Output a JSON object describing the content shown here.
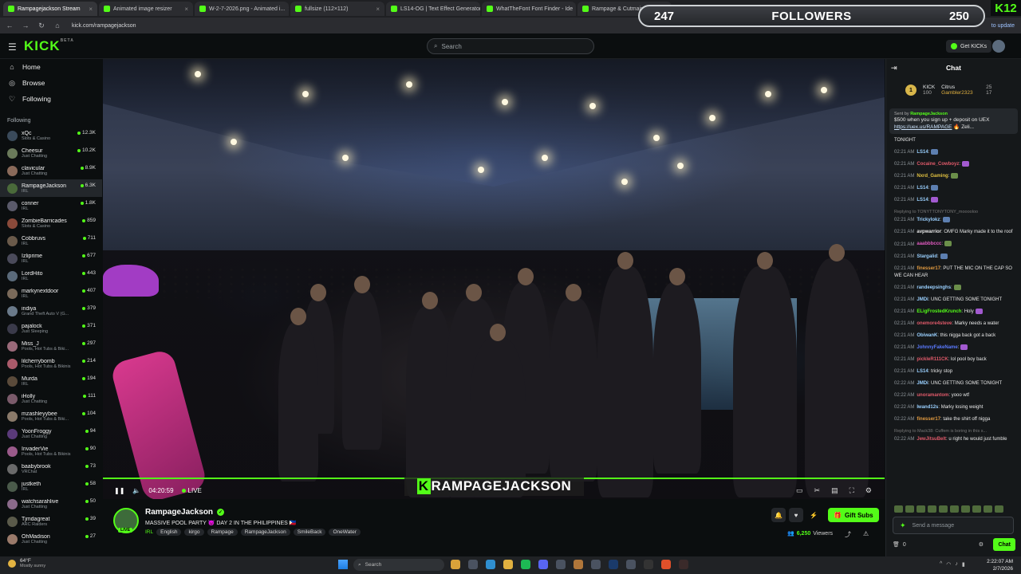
{
  "browser": {
    "tabs": [
      {
        "label": "Rampagejackson Stream"
      },
      {
        "label": "Animated image resizer"
      },
      {
        "label": "W-2-7-2026.png - Animated i..."
      },
      {
        "label": "fullsize (112×112)"
      },
      {
        "label": "LS14-OG | Text Effect Generator"
      },
      {
        "label": "WhatTheFont Font Finder - Ide"
      },
      {
        "label": "Rampage & Cutmain Tabl"
      }
    ],
    "url": "kick.com/rampagejackson",
    "update_note": "to update"
  },
  "overlay": {
    "followers_current": "247",
    "followers_label": "FOLLOWERS",
    "followers_goal": "250",
    "k_count": "12"
  },
  "kick": {
    "logo": "KICK",
    "logo_sup": "BETA",
    "search_placeholder": "Search",
    "get_kicks": "Get KICKs"
  },
  "sidebar": {
    "nav": [
      {
        "label": "Home",
        "icon": "home-icon",
        "glyph": "⌂"
      },
      {
        "label": "Browse",
        "icon": "compass-icon",
        "glyph": "◎"
      },
      {
        "label": "Following",
        "icon": "heart-icon",
        "glyph": "♡"
      }
    ],
    "following_title": "Following",
    "channels": [
      {
        "name": "xQc",
        "category": "Slots & Casino",
        "viewers": "12.3K",
        "color": "#3a4a5a"
      },
      {
        "name": "Cheesur",
        "category": "Just Chatting",
        "viewers": "10.2K",
        "color": "#6a7a5a"
      },
      {
        "name": "clavicular",
        "category": "Just Chatting",
        "viewers": "8.9K",
        "color": "#8a6a5a"
      },
      {
        "name": "RampageJackson",
        "category": "IRL",
        "viewers": "6.3K",
        "color": "#4a6a3a",
        "selected": true
      },
      {
        "name": "conner",
        "category": "IRL",
        "viewers": "1.8K",
        "color": "#5a5a6a"
      },
      {
        "name": "ZombieBarricades",
        "category": "Slots & Casino",
        "viewers": "859",
        "color": "#8a4a3a"
      },
      {
        "name": "Cobbruvs",
        "category": "IRL",
        "viewers": "711",
        "color": "#6a5a4a"
      },
      {
        "name": "Izliprime",
        "category": "IRL",
        "viewers": "677",
        "color": "#4a4a5a"
      },
      {
        "name": "LordHito",
        "category": "IRL",
        "viewers": "443",
        "color": "#5a6a7a"
      },
      {
        "name": "markynextdoor",
        "category": "IRL",
        "viewers": "407",
        "color": "#7a6a5a"
      },
      {
        "name": "indiya",
        "category": "Grand Theft Auto V (G...",
        "viewers": "379",
        "color": "#6a7a8a"
      },
      {
        "name": "pajalock",
        "category": "Just Sleeping",
        "viewers": "371",
        "color": "#3a3a4a"
      },
      {
        "name": "Miss_J",
        "category": "Pools, Hot Tubs & Biki...",
        "viewers": "297",
        "color": "#9a6a7a"
      },
      {
        "name": "lilcherrybomb",
        "category": "Pools, Hot Tubs & Bikinis",
        "viewers": "214",
        "color": "#aa5a6a"
      },
      {
        "name": "Murda",
        "category": "IRL",
        "viewers": "194",
        "color": "#5a4a3a"
      },
      {
        "name": "iHolly",
        "category": "Just Chatting",
        "viewers": "111",
        "color": "#7a5a6a"
      },
      {
        "name": "mzashleyybee",
        "category": "Pools, Hot Tubs & Biki...",
        "viewers": "104",
        "color": "#8a7a6a"
      },
      {
        "name": "YoonFroggy",
        "category": "Just Chatting",
        "viewers": "94",
        "color": "#5a3a7a"
      },
      {
        "name": "InvaderVie",
        "category": "Pools, Hot Tubs & Bikinis",
        "viewers": "90",
        "color": "#9a5a8a"
      },
      {
        "name": "baabybrook",
        "category": "VRChat",
        "viewers": "73",
        "color": "#6a6a6a"
      },
      {
        "name": "justketh",
        "category": "IRL",
        "viewers": "58",
        "color": "#4a5a4a"
      },
      {
        "name": "watchsarahlive",
        "category": "Just Chatting",
        "viewers": "50",
        "color": "#8a6a8a"
      },
      {
        "name": "Tjmdagreat",
        "category": "ARC Raiders",
        "viewers": "39",
        "color": "#5a5a4a"
      },
      {
        "name": "OhMadison",
        "category": "Just Chatting",
        "viewers": "27",
        "color": "#9a7a6a"
      }
    ]
  },
  "player": {
    "elapsed": "04:20:59",
    "live_label": "LIVE",
    "banner_first": "K",
    "banner_rest": "RAMPAGEJACKSON"
  },
  "stream": {
    "streamer": "RampageJackson",
    "title": "MASSIVE POOL PARTY 😈 DAY 2 IN THE PHILIPPINES 🇵🇭",
    "live_badge": "LIVE",
    "category": "IRL",
    "tags": [
      "English",
      "kirgo",
      "Rampage",
      "RampageJackson",
      "SmileBack",
      "OneWater"
    ],
    "gift_subs": "Gift Subs",
    "viewers": "6,250",
    "viewers_label": "Viewers"
  },
  "chat": {
    "title": "Chat",
    "leaderboard": [
      {
        "name": "KICK",
        "score": "100"
      },
      {
        "name": "Citrus",
        "score": "25"
      },
      {
        "name": "Gambler2323",
        "score": "17"
      }
    ],
    "pinned": {
      "sent_by_label": "Sent by",
      "sender": "RampageJackson",
      "text": "$500 when you sign up + deposit on UEX",
      "link": "https://uex.us/RAMPAGE",
      "suffix": "🔥 Zeli..."
    },
    "messages": [
      {
        "time": "",
        "user": "",
        "color": "#ccc",
        "text": "TONIGHT"
      },
      {
        "time": "02:21 AM",
        "user": "LS14",
        "color": "#9ad0ff",
        "text": ":",
        "emote": true
      },
      {
        "time": "02:21 AM",
        "user": "Cocaine_Cowboyz",
        "color": "#e05a6a",
        "text": ":",
        "emote": true
      },
      {
        "time": "02:21 AM",
        "user": "Nxrd_Gaming",
        "color": "#e0c040",
        "text": ":",
        "emote": true
      },
      {
        "time": "02:21 AM",
        "user": "LS14",
        "color": "#9ad0ff",
        "text": ":",
        "emote": true
      },
      {
        "time": "02:21 AM",
        "user": "LS14",
        "color": "#9ad0ff",
        "text": ":",
        "emote": true
      },
      {
        "reply": "Replying to TONYTTONYTONY_mooooloo"
      },
      {
        "time": "02:21 AM",
        "user": "Trickylokz",
        "color": "#9ad0ff",
        "text": ":",
        "emote": true
      },
      {
        "time": "02:21 AM",
        "user": "avpwarrior",
        "color": "#e8e8e8",
        "text": ": OMFG Marky made it to the roof"
      },
      {
        "time": "02:21 AM",
        "user": "aaabbbccc",
        "color": "#e05ac0",
        "text": ":",
        "emote": true
      },
      {
        "time": "02:21 AM",
        "user": "Stargalid",
        "color": "#9ad0ff",
        "text": ":",
        "emote": true
      },
      {
        "time": "02:21 AM",
        "user": "finesser17",
        "color": "#e09a40",
        "text": ": PUT THE MIC ON THE CAP SO WE CAN HEAR"
      },
      {
        "time": "02:21 AM",
        "user": "randeepsinghs",
        "color": "#9ad0ff",
        "text": ":",
        "emote": true
      },
      {
        "time": "02:21 AM",
        "user": "JMDi",
        "color": "#9ad0ff",
        "text": ": UNC GETTING SOME TONIGHT"
      },
      {
        "time": "02:21 AM",
        "user": "ELigFrostedKrunch",
        "color": "#53fc18",
        "text": ": Holy",
        "emote": true
      },
      {
        "time": "02:21 AM",
        "user": "onemore4steve",
        "color": "#e05a6a",
        "text": ": Marky needs a water"
      },
      {
        "time": "02:21 AM",
        "user": "ObiwanK",
        "color": "#9ad0ff",
        "text": ": this nigga back got a back"
      },
      {
        "time": "02:21 AM",
        "user": "JohnnyFakeName",
        "color": "#5a7aff",
        "text": ":",
        "emote": true
      },
      {
        "time": "02:21 AM",
        "user": "pickleR111CK",
        "color": "#e05a6a",
        "text": ": lol pool boy back"
      },
      {
        "time": "02:21 AM",
        "user": "LS14",
        "color": "#9ad0ff",
        "text": ": tricky stop"
      },
      {
        "time": "02:22 AM",
        "user": "JMDi",
        "color": "#9ad0ff",
        "text": ": UNC GETTING SOME TONIGHT"
      },
      {
        "time": "02:22 AM",
        "user": "unoramantom",
        "color": "#e05a6a",
        "text": ": yooo wtf"
      },
      {
        "time": "02:22 AM",
        "user": "Iwand12s",
        "color": "#9ad0ff",
        "text": ": Marky losing weight"
      },
      {
        "time": "02:22 AM",
        "user": "finesser17",
        "color": "#e09a40",
        "text": ": take the shirt off nigga"
      },
      {
        "reply": "Replying to Mack38: Cuffem is boring in this s..."
      },
      {
        "time": "02:22 AM",
        "user": "JewJitsuBelt",
        "color": "#e05a6a",
        "text": ": u right he would just fumble"
      }
    ],
    "input_placeholder": "Send a message",
    "points": "0",
    "send_label": "Chat"
  },
  "taskbar": {
    "temp": "64°F",
    "weather": "Mostly sunny",
    "search": "Search",
    "time": "2:22:07 AM",
    "date": "2/7/2026"
  }
}
